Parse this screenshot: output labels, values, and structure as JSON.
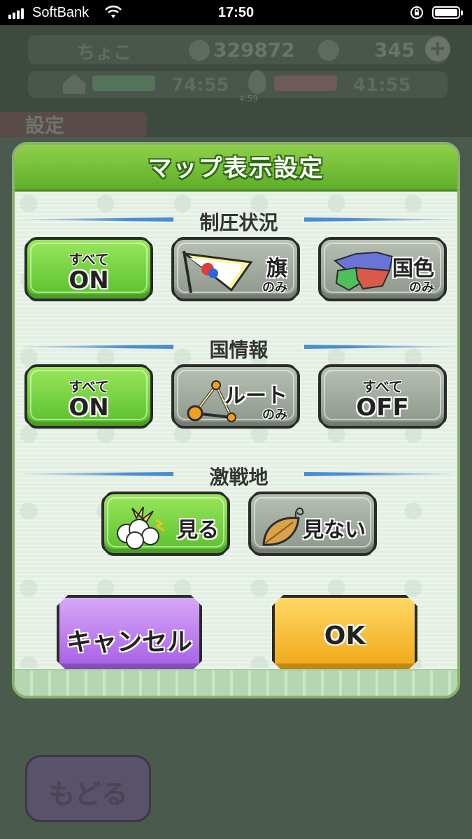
{
  "status_bar": {
    "carrier": "SoftBank",
    "time": "17:50"
  },
  "background": {
    "player_name": "ちょこ",
    "coins": "329872",
    "gems": "345",
    "timer1": "74:55",
    "timer2": "41:55",
    "small_timer": "4:59",
    "settings_label": "設定",
    "back_button": "もどる"
  },
  "dialog": {
    "title": "マップ表示設定",
    "sections": [
      {
        "label": "制圧状況",
        "options": [
          {
            "small": "すべて",
            "big": "ON",
            "selected": true
          },
          {
            "main": "旗",
            "sub": "のみ",
            "icon": "flag-icon",
            "selected": false
          },
          {
            "main": "国色",
            "sub": "のみ",
            "icon": "map-color-icon",
            "selected": false
          }
        ]
      },
      {
        "label": "国情報",
        "options": [
          {
            "small": "すべて",
            "big": "ON",
            "selected": true
          },
          {
            "main": "ルート",
            "sub": "のみ",
            "icon": "route-icon",
            "selected": false
          },
          {
            "small": "すべて",
            "big": "OFF",
            "selected": false
          }
        ]
      },
      {
        "label": "激戦地",
        "options": [
          {
            "main": "見る",
            "icon": "battle-cloud-icon",
            "selected": true
          },
          {
            "main": "見ない",
            "icon": "leaf-icon",
            "selected": false
          }
        ]
      }
    ],
    "cancel_label": "キャンセル",
    "ok_label": "OK"
  },
  "colors": {
    "selected": "#6fd23a",
    "unselected": "#a3ac9f",
    "cancel": "#b878ee",
    "ok": "#f6c03a",
    "header": "#72bf35",
    "divider": "#4a8dd0"
  }
}
